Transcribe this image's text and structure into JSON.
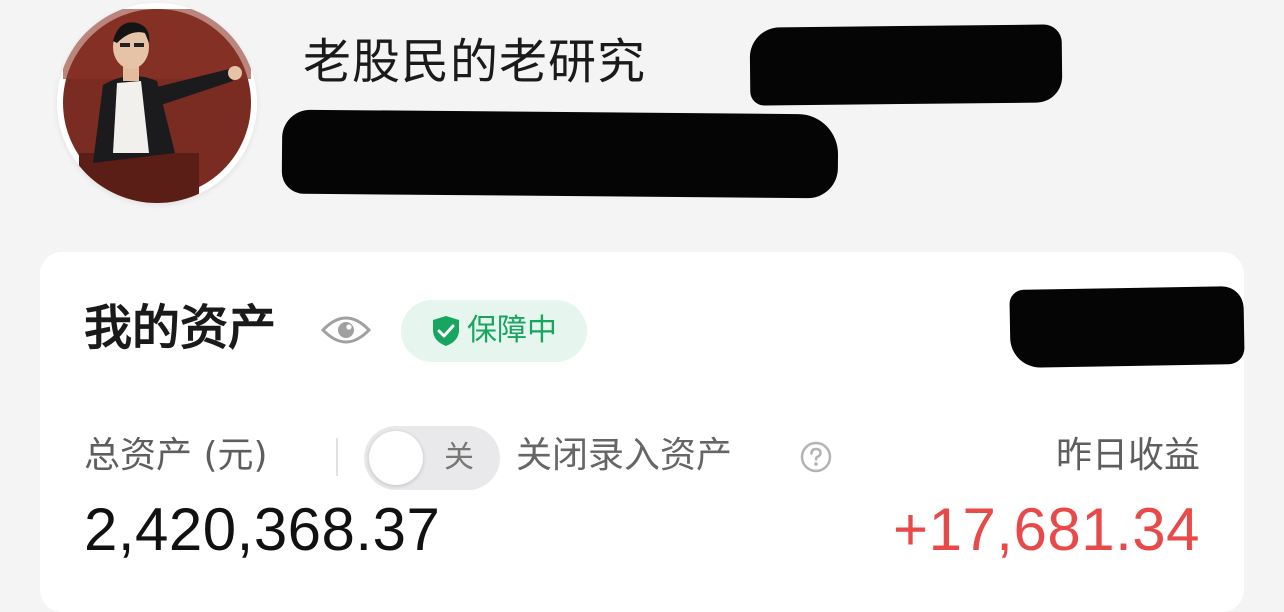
{
  "profile": {
    "username": "老股民的老研究"
  },
  "assets": {
    "title": "我的资产",
    "protection_badge": "保障中",
    "total_label": "总资产 (元)",
    "toggle_state": "关",
    "toggle_label": "关闭录入资产",
    "total_value": "2,420,368.37",
    "yesterday_label": "昨日收益",
    "yesterday_value": "+17,681.34"
  },
  "colors": {
    "page_background": "#f4f4f5",
    "card_background": "#ffffff",
    "badge_background": "#e6f6ef",
    "badge_green": "#17a560",
    "gain_red": "#e84a4a"
  },
  "icons": {
    "visibility": "eye-icon",
    "badge": "shield-check-icon",
    "help": "question-circle-icon"
  }
}
